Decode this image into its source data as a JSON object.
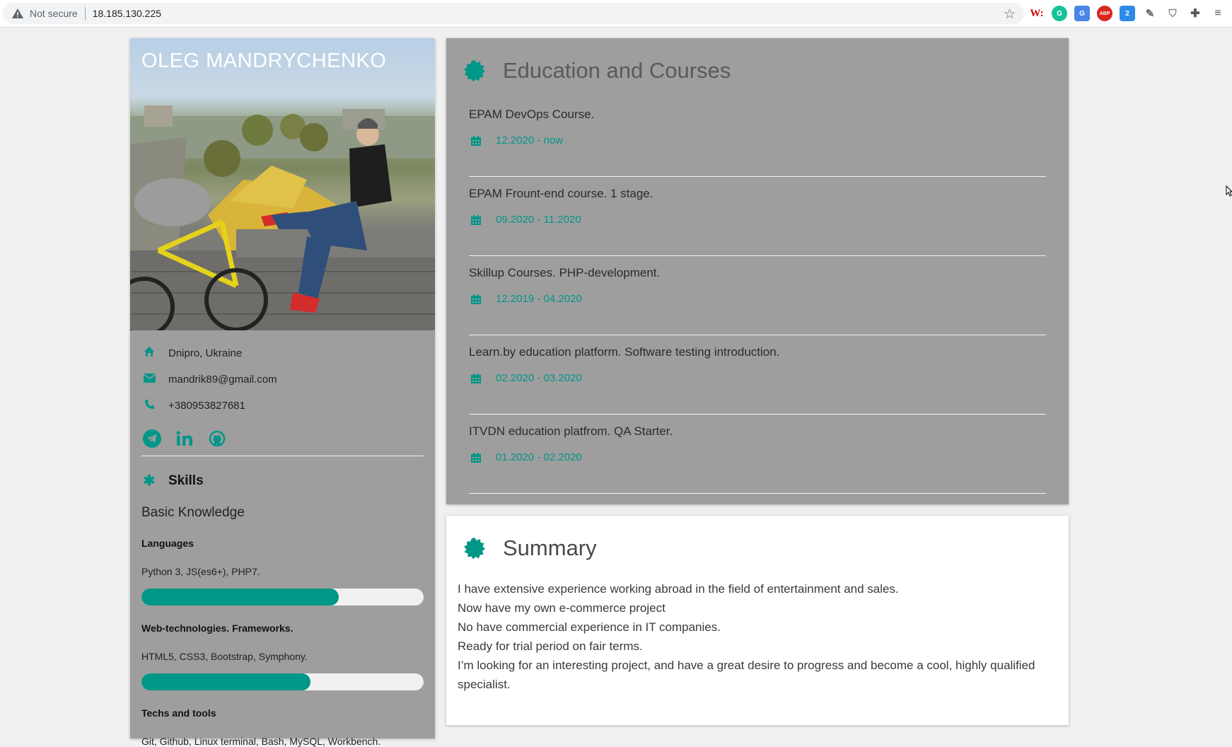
{
  "browser": {
    "security_text": "Not secure",
    "url": "18.185.130.225",
    "bookmark_icon": "star-icon",
    "extensions": [
      {
        "name": "w-extension-icon",
        "glyph": "W:"
      },
      {
        "name": "grammarly-icon",
        "glyph": "G"
      },
      {
        "name": "translate-icon",
        "glyph": "G"
      },
      {
        "name": "adblock-icon",
        "glyph": "ABP"
      },
      {
        "name": "blue-extension-icon",
        "glyph": "2"
      },
      {
        "name": "pencil-extension-icon",
        "glyph": "✎"
      },
      {
        "name": "shield-extension-icon",
        "glyph": "⛉"
      },
      {
        "name": "puzzle-extensions-icon",
        "glyph": "✚"
      },
      {
        "name": "reading-list-icon",
        "glyph": "≡"
      }
    ]
  },
  "profile": {
    "name": "OLEG MANDRYCHENKO",
    "location": "Dnipro, Ukraine",
    "email": "mandrik89@gmail.com",
    "phone": "+380953827681",
    "socials": [
      "telegram-icon",
      "linkedin-icon",
      "github-icon"
    ]
  },
  "skills": {
    "heading": "Skills",
    "level_title": "Basic Knowledge",
    "groups": [
      {
        "title": "Languages",
        "desc": "Python 3, JS(es6+), PHP7.",
        "level": 0.7
      },
      {
        "title": "Web-technologies. Frameworks.",
        "desc": "HTML5, CSS3, Bootstrap, Symphony.",
        "level": 0.6
      },
      {
        "title": "Techs and tools",
        "desc": "Git, Github, Linux terminal, Bash, MySQL, Workbench."
      }
    ]
  },
  "education": {
    "heading": "Education and Courses",
    "items": [
      {
        "title": "EPAM DevOps Course.",
        "dates": "12.2020 - now"
      },
      {
        "title": "EPAM Frount-end course. 1 stage.",
        "dates": "09.2020 - 11.2020"
      },
      {
        "title": "Skillup Courses. PHP-development.",
        "dates": "12.2019 - 04.2020"
      },
      {
        "title": "Learn.by education platform. Software testing introduction.",
        "dates": "02.2020 - 03.2020"
      },
      {
        "title": "ITVDN education platfrom. QA Starter.",
        "dates": "01.2020 - 02.2020"
      }
    ]
  },
  "summary": {
    "heading": "Summary",
    "lines": [
      "I have extensive experience working abroad in the field of entertainment and sales.",
      "Now have my own e-commerce project",
      "No have commercial experience in IT companies.",
      "Ready for trial period on fair terms.",
      "I’m looking for an interesting project, and have a great desire to progress and become a cool, highly qualified specialist."
    ]
  },
  "colors": {
    "accent": "#009688",
    "card_grey": "#9e9e9e",
    "page_bg": "#f0f0f0"
  }
}
